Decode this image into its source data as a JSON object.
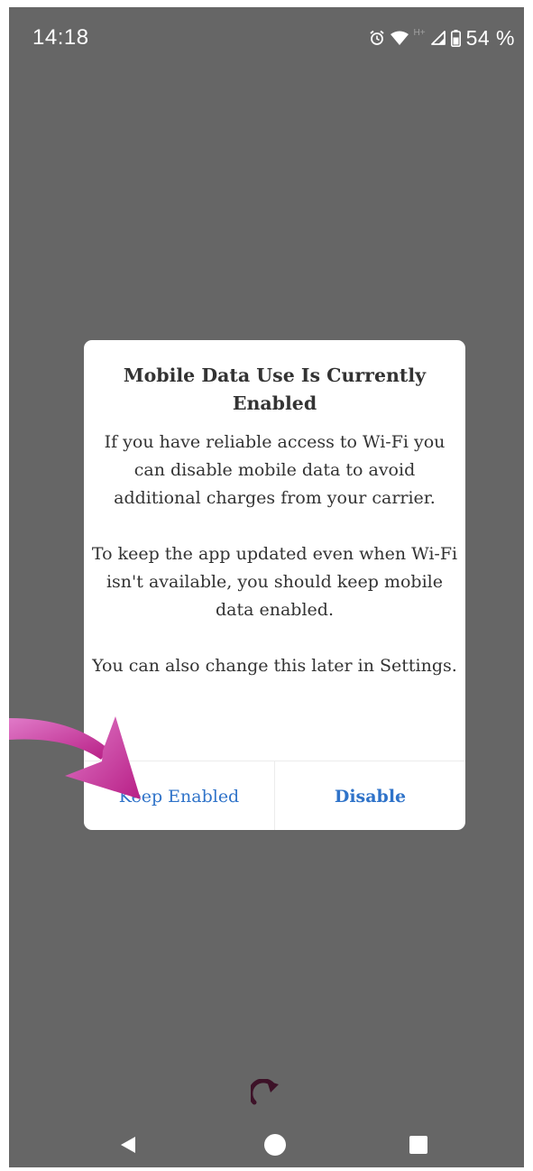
{
  "status_bar": {
    "time": "14:18",
    "network_type": "H+",
    "battery": "54 %",
    "icons": [
      "alarm-icon",
      "wifi-icon",
      "signal-icon",
      "battery-icon"
    ]
  },
  "dialog": {
    "title": "Mobile Data Use Is Currently Enabled",
    "paragraphs": [
      "If you have reliable access to Wi-Fi you can disable mobile data to avoid additional charges from your carrier.",
      "To keep the app updated even when Wi-Fi isn't available, you should keep mobile data enabled.",
      "You can also change this later in Settings."
    ],
    "buttons": {
      "keep": "Keep Enabled",
      "disable": "Disable"
    }
  },
  "nav_bar": {
    "icons": [
      "back-icon",
      "home-icon",
      "recents-icon"
    ]
  },
  "colors": {
    "backdrop": "#666666",
    "dialog_bg": "#ffffff",
    "button_text": "#2f73c9",
    "body_text": "#333333",
    "annotation_arrow": "#c2309a"
  }
}
